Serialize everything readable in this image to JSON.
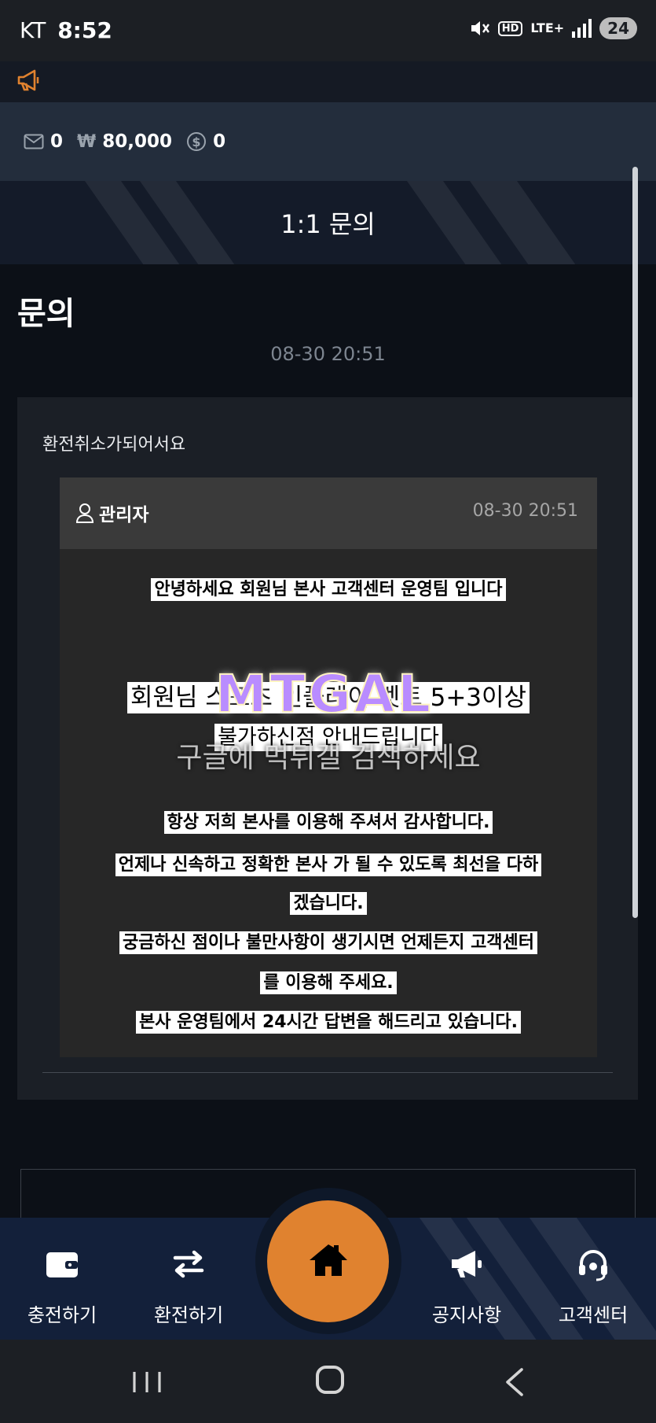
{
  "status_bar": {
    "carrier": "KT",
    "time": "8:52",
    "hd": "HD",
    "network": "LTE+",
    "battery": "24"
  },
  "balance": {
    "messages": "0",
    "money": "80,000",
    "points": "0"
  },
  "header": {
    "title": "1:1 문의"
  },
  "inquiry": {
    "heading": "문의",
    "date": "08-30 20:51",
    "subject": "환전취소가되어서요",
    "reply": {
      "author": "관리자",
      "date": "08-30 20:51",
      "line1": "안녕하세요 회원님 본사 고객센터 운영팀 입니다",
      "line2": "회원님 스포츠 인플레이 벳트 5+3이상",
      "line3": "불가하신점 안내드립니다",
      "line4": "항상 저희 본사를 이용해 주셔서 감사합니다.",
      "line5": "언제나 신속하고 정확한 본사 가 될 수 있도록 최선을 다하",
      "line6": "겠습니다.",
      "line7": "궁금하신 점이나 불만사항이 생기시면 언제든지 고객센터",
      "line8": "를 이용해 주세요.",
      "line9": "본사 운영팀에서 24시간 답변을 해드리고 있습니다."
    }
  },
  "watermark": {
    "logo": "MTGAL",
    "text": "구글에 먹튀갤 검색하세요"
  },
  "bottom_nav": {
    "deposit": "충전하기",
    "withdraw": "환전하기",
    "notice": "공지사항",
    "support": "고객센터"
  },
  "colors": {
    "accent": "#e0822f",
    "nav_bg": "#13203a",
    "banner_bg": "#141b29"
  }
}
